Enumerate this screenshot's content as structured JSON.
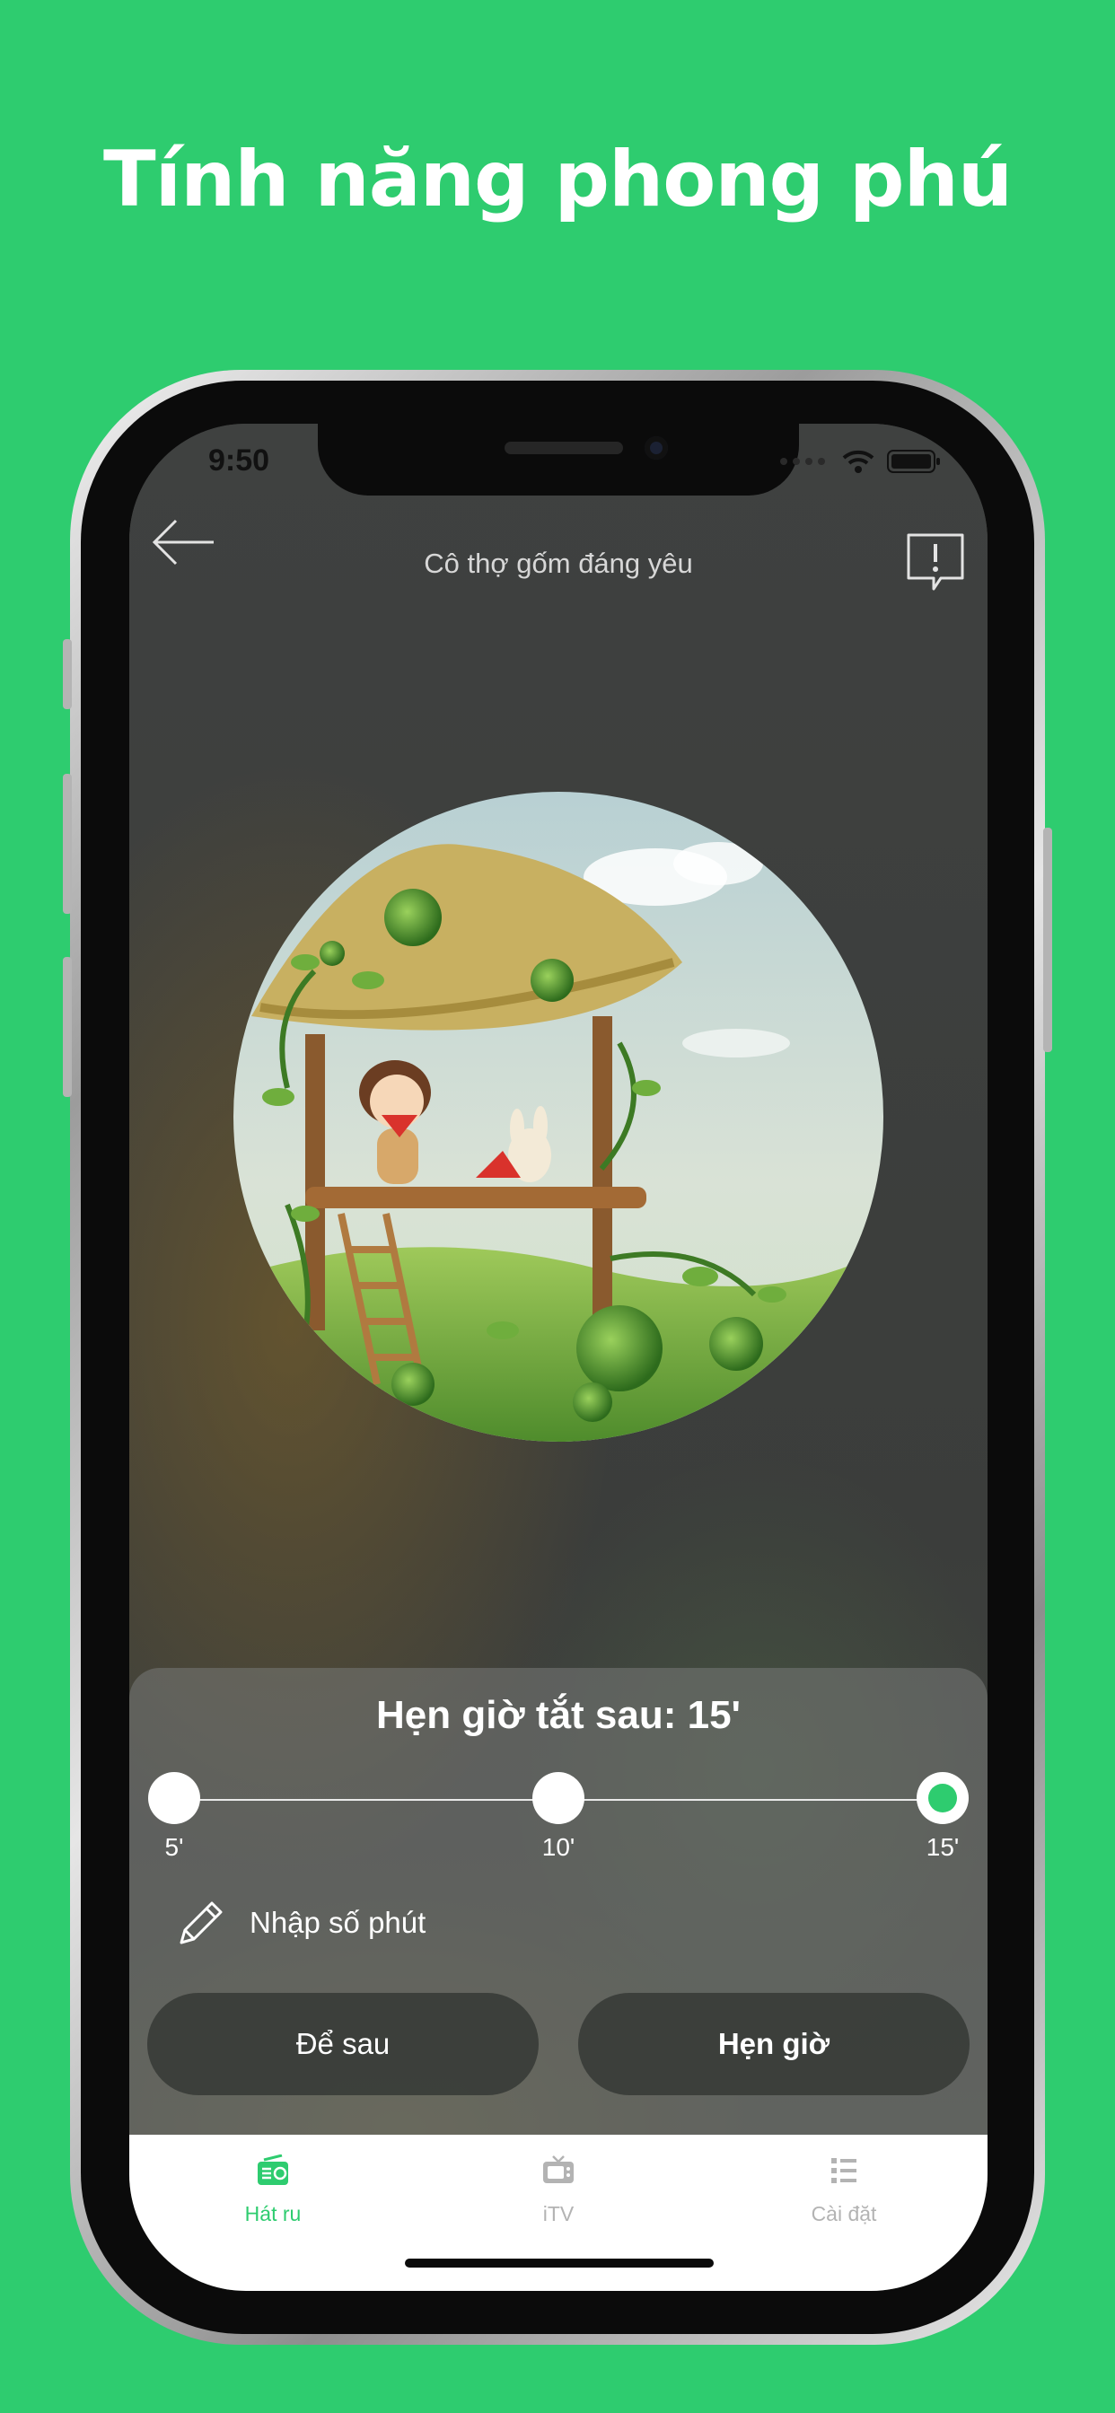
{
  "headline": "Tính năng phong phú",
  "status_bar": {
    "time": "9:50"
  },
  "nav": {
    "title": "Cô thợ gốm đáng yêu",
    "back_icon": "arrow-left-icon",
    "report_icon": "report-bubble-icon"
  },
  "timer_sheet": {
    "title": "Hẹn giờ tắt sau: 15'",
    "options": [
      "5'",
      "10'",
      "15'"
    ],
    "selected": "15'",
    "manual_label": "Nhập số phút",
    "later_button": "Để sau",
    "set_button": "Hẹn giờ"
  },
  "tabs": [
    {
      "label": "Hát ru",
      "icon": "radio-icon",
      "active": true
    },
    {
      "label": "iTV",
      "icon": "tv-icon",
      "active": false
    },
    {
      "label": "Cài đặt",
      "icon": "settings-list-icon",
      "active": false
    }
  ],
  "colors": {
    "brand_green": "#2ecc6f",
    "tab_inactive": "#b3b3b3"
  }
}
